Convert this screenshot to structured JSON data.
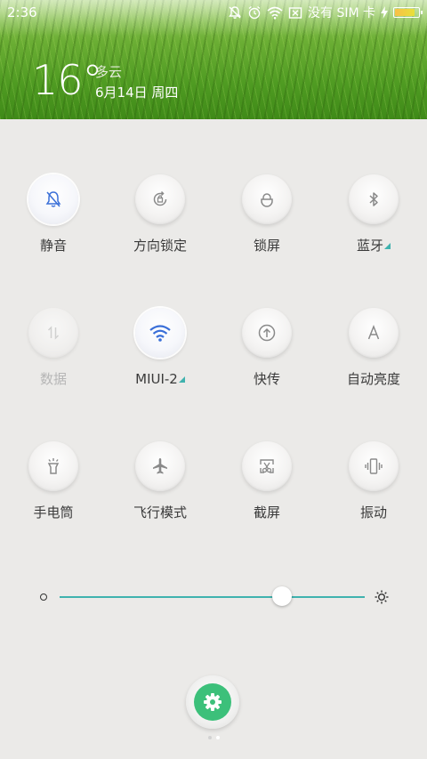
{
  "status_bar": {
    "time": "2:36",
    "carrier_text": "没有 SIM 卡",
    "battery_level": 0.85,
    "icons": [
      "mute-icon",
      "alarm-icon",
      "wifi-icon",
      "no-sim-icon",
      "charging-icon",
      "battery-icon"
    ]
  },
  "weather": {
    "temperature": "16°",
    "condition": "多云",
    "date": "6月14日 周四"
  },
  "toggles": [
    {
      "label": "静音",
      "icon": "bell-off-icon",
      "state": "on"
    },
    {
      "label": "方向锁定",
      "icon": "rotation-lock-icon",
      "state": "off"
    },
    {
      "label": "锁屏",
      "icon": "lock-icon",
      "state": "off"
    },
    {
      "label": "蓝牙",
      "icon": "bluetooth-icon",
      "state": "off",
      "has_more": true
    },
    {
      "label": "数据",
      "icon": "mobile-data-icon",
      "state": "disabled"
    },
    {
      "label": "MIUI-2",
      "icon": "wifi-icon",
      "state": "on",
      "has_more": true
    },
    {
      "label": "快传",
      "icon": "share-upload-icon",
      "state": "off"
    },
    {
      "label": "自动亮度",
      "icon": "auto-brightness-icon",
      "state": "off"
    },
    {
      "label": "手电筒",
      "icon": "flashlight-icon",
      "state": "off"
    },
    {
      "label": "飞行模式",
      "icon": "airplane-icon",
      "state": "off"
    },
    {
      "label": "截屏",
      "icon": "screenshot-icon",
      "state": "off"
    },
    {
      "label": "振动",
      "icon": "vibrate-icon",
      "state": "off"
    }
  ],
  "brightness": {
    "level": 0.73,
    "low_icon": "brightness-low-icon",
    "high_icon": "brightness-high-icon"
  },
  "settings": {
    "icon": "gear-icon",
    "color": "#3cc07a"
  },
  "pager": {
    "pages": 2,
    "current": 2
  },
  "colors": {
    "accent": "#3fb2ae",
    "active_icon": "#3a6fd8",
    "icon": "#8a8a8a"
  }
}
